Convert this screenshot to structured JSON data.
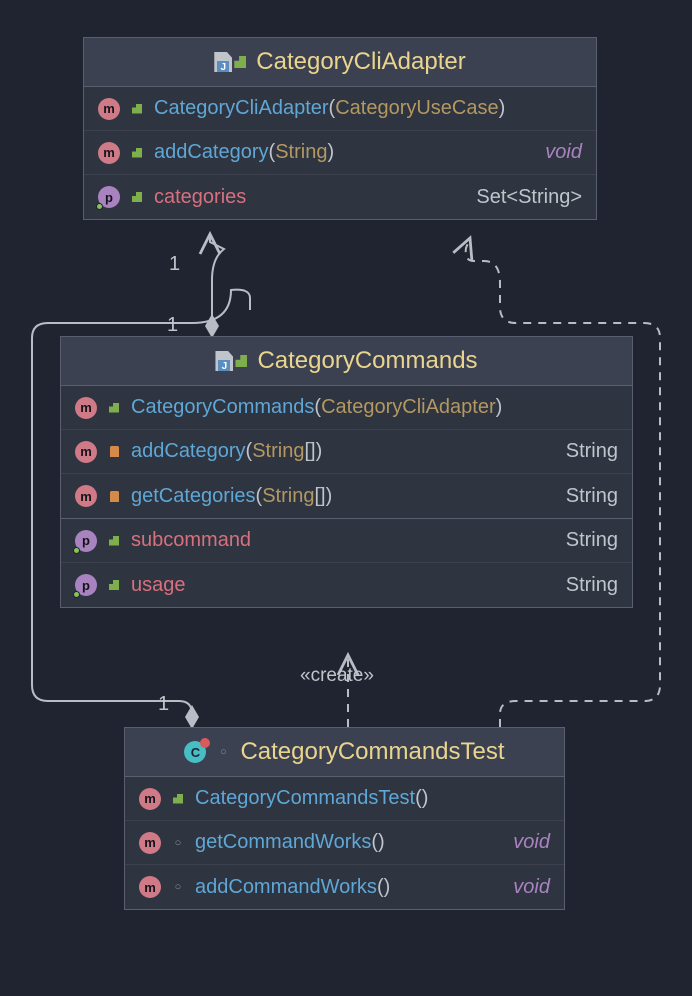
{
  "classes": {
    "adapter": {
      "title": "CategoryCliAdapter",
      "members": [
        {
          "k": "m",
          "v": "pub",
          "name": "CategoryCliAdapter",
          "param": "CategoryUseCase",
          "ret": ""
        },
        {
          "k": "m",
          "v": "pub",
          "name": "addCategory",
          "param": "String",
          "ret": "void"
        },
        {
          "k": "p",
          "v": "pub",
          "name": "categories",
          "param": "",
          "ret": "Set<String>"
        }
      ]
    },
    "commands": {
      "title": "CategoryCommands",
      "members": [
        {
          "k": "m",
          "v": "pub",
          "name": "CategoryCommands",
          "param": "CategoryCliAdapter",
          "ret": ""
        },
        {
          "k": "m",
          "v": "priv",
          "name": "addCategory",
          "param": "String[]",
          "ret": "String"
        },
        {
          "k": "m",
          "v": "priv",
          "name": "getCategories",
          "param": "String[]",
          "ret": "String"
        },
        {
          "k": "p",
          "v": "pub",
          "name": "subcommand",
          "param": "",
          "ret": "String"
        },
        {
          "k": "p",
          "v": "pub",
          "name": "usage",
          "param": "",
          "ret": "String"
        }
      ]
    },
    "test": {
      "title": "CategoryCommandsTest",
      "members": [
        {
          "k": "m",
          "v": "pub",
          "name": "CategoryCommandsTest",
          "param": "",
          "ret": ""
        },
        {
          "k": "m",
          "v": "pkg",
          "name": "getCommandWorks",
          "param": "",
          "ret": "void"
        },
        {
          "k": "m",
          "v": "pkg",
          "name": "addCommandWorks",
          "param": "",
          "ret": "void"
        }
      ]
    }
  },
  "labels": {
    "m1": "1",
    "m2": "1",
    "m3": "1",
    "stereo": "«create»"
  }
}
